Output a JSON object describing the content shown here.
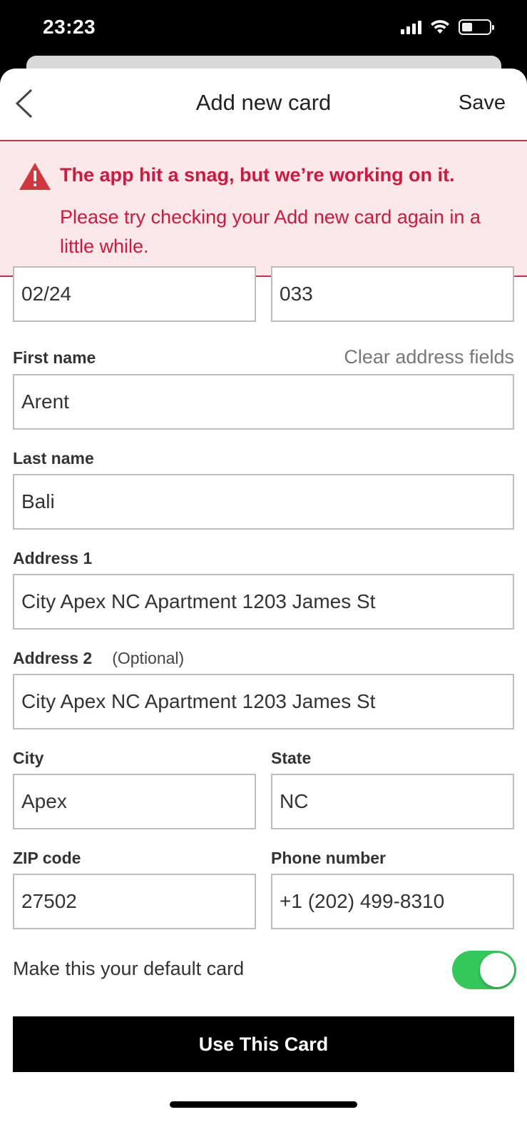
{
  "status_bar": {
    "time": "23:23"
  },
  "nav": {
    "title": "Add new card",
    "save_label": "Save"
  },
  "error_banner": {
    "title": "The app hit a snag, but we’re working on it.",
    "message": "Please try checking your Add new card again in a little while."
  },
  "card": {
    "expiry": "02/24",
    "cvv": "033"
  },
  "form": {
    "first_name": {
      "label": "First name",
      "value": "Arent"
    },
    "clear_link": "Clear address fields",
    "last_name": {
      "label": "Last name",
      "value": "Bali"
    },
    "address1": {
      "label": "Address 1",
      "value": "City Apex NC Apartment 1203 James St"
    },
    "address2": {
      "label": "Address 2",
      "optional": "(Optional)",
      "value": "City Apex NC Apartment 1203 James St"
    },
    "city": {
      "label": "City",
      "value": "Apex"
    },
    "state": {
      "label": "State",
      "value": "NC"
    },
    "zip": {
      "label": "ZIP code",
      "value": "27502"
    },
    "phone": {
      "label": "Phone number",
      "value": "+1 (202) 499-8310"
    }
  },
  "default_card": {
    "label": "Make this your default card",
    "enabled": true
  },
  "primary_button": {
    "label": "Use This Card"
  },
  "colors": {
    "error": "#d1173d",
    "error_bg": "#fbe9ea",
    "toggle_on": "#34c759",
    "button": "#000000"
  },
  "icons": {
    "back": "chevron-left-icon",
    "warning": "warning-triangle-icon"
  }
}
